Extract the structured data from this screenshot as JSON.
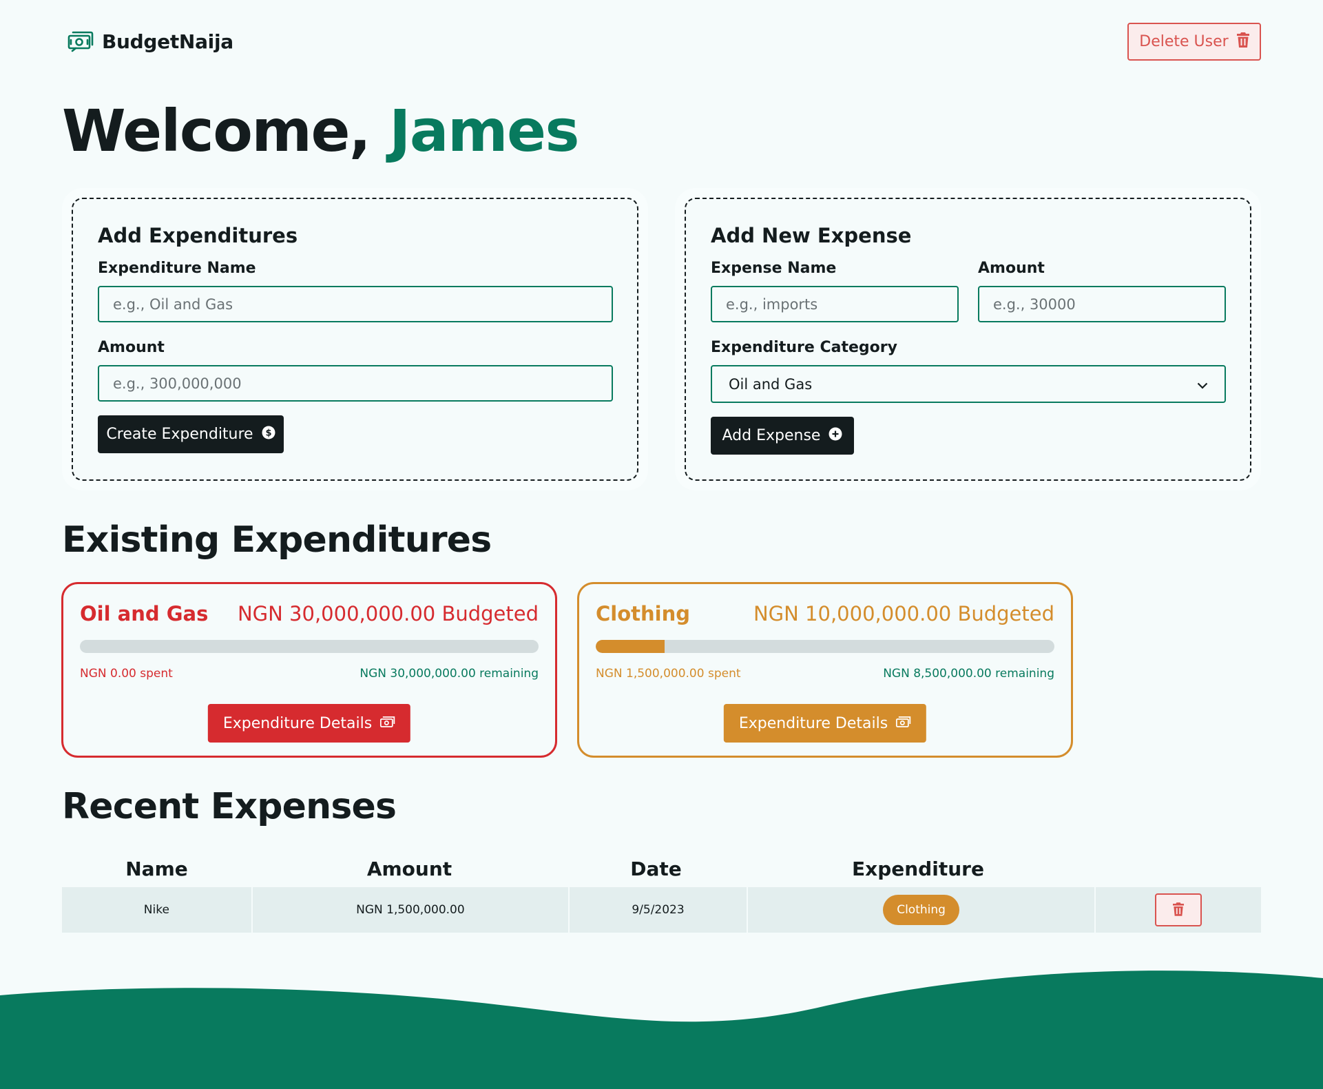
{
  "brand": {
    "name": "BudgetNaija"
  },
  "header": {
    "delete_user_label": "Delete User"
  },
  "welcome": {
    "greeting": "Welcome,",
    "user_name": "James"
  },
  "add_expenditures": {
    "title": "Add Expenditures",
    "name_label": "Expenditure Name",
    "name_placeholder": "e.g., Oil and Gas",
    "amount_label": "Amount",
    "amount_placeholder": "e.g., 300,000,000",
    "submit_label": "Create Expenditure"
  },
  "add_expense": {
    "title": "Add New Expense",
    "name_label": "Expense Name",
    "name_placeholder": "e.g., imports",
    "amount_label": "Amount",
    "amount_placeholder": "e.g., 30000",
    "category_label": "Expenditure Category",
    "category_selected": "Oil and Gas",
    "submit_label": "Add Expense"
  },
  "existing_expenditures": {
    "title": "Existing Expenditures",
    "cards": [
      {
        "name": "Oil and Gas",
        "budgeted": "NGN 30,000,000.00 Budgeted",
        "spent": "NGN 0.00 spent",
        "remaining": "NGN 30,000,000.00 remaining",
        "progress_fraction": 0.0,
        "details_label": "Expenditure Details",
        "color": "#d62b2f"
      },
      {
        "name": "Clothing",
        "budgeted": "NGN 10,000,000.00 Budgeted",
        "spent": "NGN 1,500,000.00 spent",
        "remaining": "NGN 8,500,000.00 remaining",
        "progress_fraction": 0.15,
        "details_label": "Expenditure Details",
        "color": "#d48d2c"
      }
    ]
  },
  "recent_expenses": {
    "title": "Recent Expenses",
    "columns": [
      "Name",
      "Amount",
      "Date",
      "Expenditure"
    ],
    "rows": [
      {
        "name": "Nike",
        "amount": "NGN 1,500,000.00",
        "date": "9/5/2023",
        "expenditure": "Clothing"
      }
    ]
  },
  "colors": {
    "primary": "#087a5e",
    "dark": "#141c1e",
    "danger": "#d9534f",
    "background": "#f5fbfb"
  }
}
